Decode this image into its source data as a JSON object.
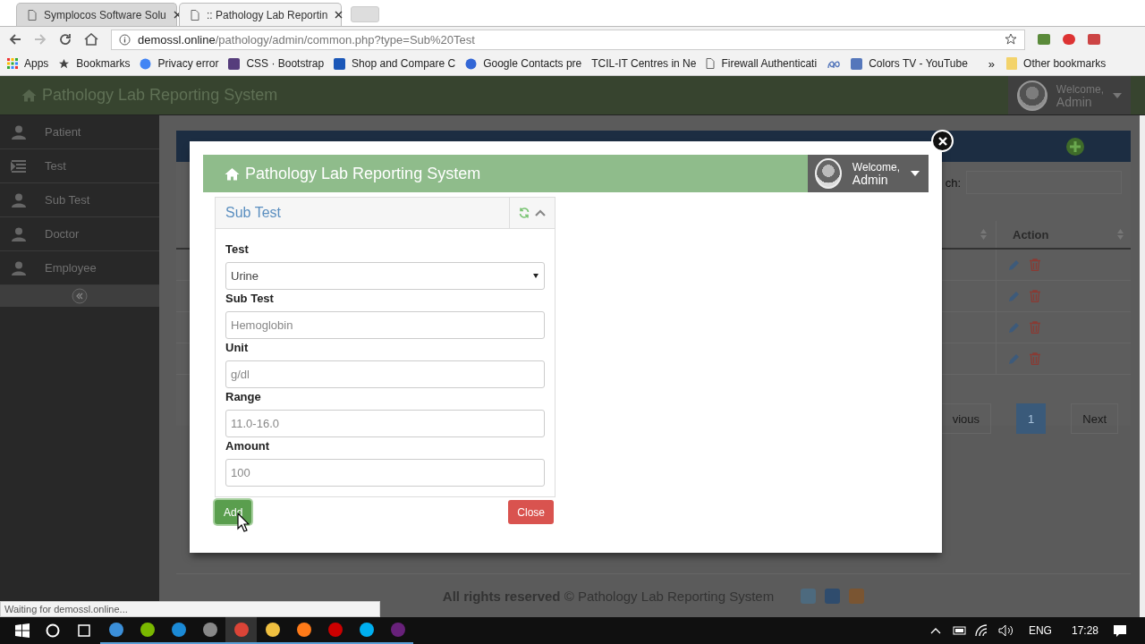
{
  "browser": {
    "tabs": [
      {
        "title": "Symplocos Software Solu",
        "selected": false
      },
      {
        "title": ":: Pathology Lab Reportin",
        "selected": true
      }
    ],
    "address": {
      "host": "demossl.online",
      "path": "/pathology/admin/common.php?type=Sub%20Test"
    },
    "bookmarks": [
      {
        "label": "Apps"
      },
      {
        "label": "Bookmarks"
      },
      {
        "label": "Privacy error"
      },
      {
        "label": "CSS · Bootstrap"
      },
      {
        "label": "Shop and Compare C"
      },
      {
        "label": "Google Contacts pre"
      },
      {
        "label": "TCIL-IT Centres in Ne"
      },
      {
        "label": "Firewall Authenticati"
      },
      {
        "label": "Colors TV - YouTube"
      }
    ],
    "overflow": "»",
    "other_bookmarks": "Other bookmarks"
  },
  "app": {
    "title": "Pathology Lab Reporting System",
    "user": {
      "greeting": "Welcome,",
      "name": "Admin"
    },
    "sidebar": [
      {
        "label": "Patient"
      },
      {
        "label": "Test"
      },
      {
        "label": "Sub Test"
      },
      {
        "label": "Doctor"
      },
      {
        "label": "Employee"
      }
    ],
    "search_label": "ch:",
    "table": {
      "columns": [
        "Action"
      ],
      "rows": [
        {
          "editable": true
        },
        {
          "editable": true
        },
        {
          "editable": true
        },
        {
          "editable": true
        }
      ]
    },
    "pagination": [
      {
        "label": "vious",
        "selected": false
      },
      {
        "label": "1",
        "selected": true
      },
      {
        "label": "Next",
        "selected": false
      }
    ],
    "footer": "**All rights reserved** © Pathology Lab Reporting System"
  },
  "modal": {
    "title": "Pathology Lab Reporting System",
    "user": {
      "greeting": "Welcome,",
      "name": "Admin"
    },
    "panel_title": "Sub Test",
    "fields": [
      {
        "label": "Test",
        "kind": "select",
        "value": "Urine"
      },
      {
        "label": "Sub Test",
        "kind": "input",
        "placeholder": "Hemoglobin"
      },
      {
        "label": "Unit",
        "kind": "input",
        "placeholder": "g/dl"
      },
      {
        "label": "Range",
        "kind": "input",
        "placeholder": "11.0-16.0"
      },
      {
        "label": "Amount",
        "kind": "input",
        "placeholder": "100"
      }
    ],
    "buttons": [
      {
        "label": "Add",
        "kind": "primary"
      },
      {
        "label": "Close",
        "kind": "danger"
      }
    ]
  },
  "status": "Waiting for demossl.online...",
  "taskbar": {
    "language": "ENG",
    "time": "17:28"
  }
}
